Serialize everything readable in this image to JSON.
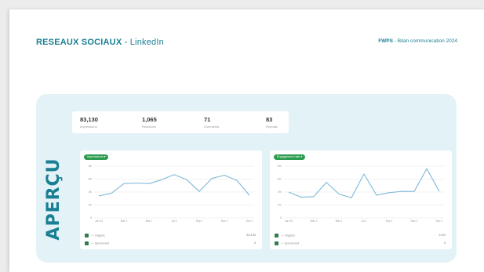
{
  "header": {
    "title_bold": "RESEAUX SOCIAUX",
    "title_rest": " - LinkedIn",
    "right_bold": "FWPS",
    "right_rest": " - Bilan communication 2024"
  },
  "section_label": "APERÇU",
  "stats": [
    {
      "value": "83,130",
      "label": "Impressions"
    },
    {
      "value": "1,065",
      "label": "Reactions"
    },
    {
      "value": "71",
      "label": "Comments"
    },
    {
      "value": "83",
      "label": "Reposts"
    }
  ],
  "colors": {
    "accent": "#1a7f94",
    "panel": "#e3f2f6",
    "line": "#7fb9d8",
    "pill": "#2e9c4f"
  },
  "chart_data": [
    {
      "type": "line",
      "title": "Impressions",
      "x": [
        "Jan 24",
        "Mar 1",
        "Mar 1",
        "Jul 1",
        "Sep 1",
        "Nov 1",
        "Dec 1"
      ],
      "y_ticks": [
        "8K",
        "6K",
        "4K",
        "2K",
        "0"
      ],
      "ylim": [
        0,
        8000
      ],
      "series": [
        {
          "values": [
            3400,
            3800,
            5300,
            5400,
            5300,
            5900,
            6700,
            5900,
            4100,
            6100,
            6600,
            5800,
            3500
          ]
        }
      ],
      "legend": [
        {
          "label": "Organic",
          "value": "83,130",
          "symbol": "checkbox"
        },
        {
          "label": "Sponsored",
          "value": "0",
          "symbol": "checkbox"
        }
      ]
    },
    {
      "type": "line",
      "title": "Engagement rate",
      "x": [
        "Jan 24",
        "Mar 1",
        "Mar 1",
        "Jul 1",
        "Sep 1",
        "Nov 1",
        "Dec 1"
      ],
      "y_ticks": [
        "8%",
        "6%",
        "4%",
        "2%",
        "0"
      ],
      "ylim": [
        0,
        8
      ],
      "series": [
        {
          "values": [
            4.0,
            3.2,
            3.3,
            5.5,
            3.7,
            3.1,
            6.8,
            3.5,
            3.9,
            4.1,
            4.1,
            7.6,
            4.1
          ]
        }
      ],
      "legend": [
        {
          "label": "Organic",
          "value": "3.3%",
          "symbol": "checkbox"
        },
        {
          "label": "Sponsored",
          "value": "0",
          "symbol": "checkbox"
        }
      ]
    }
  ]
}
